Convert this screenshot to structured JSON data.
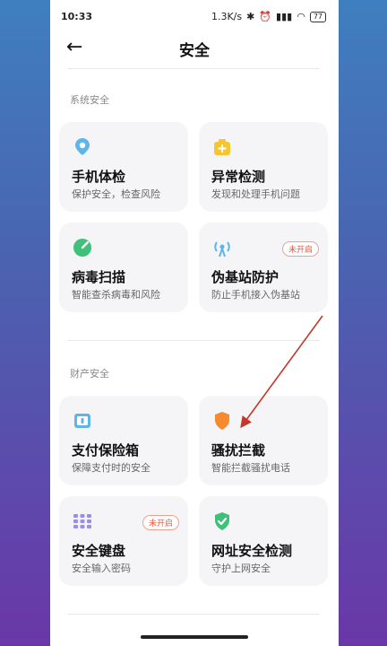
{
  "status_bar": {
    "time": "10:33",
    "net_speed": "1.3K/s",
    "battery": "77"
  },
  "header": {
    "title": "安全",
    "back_icon": "arrow-left-icon"
  },
  "sections": [
    {
      "label": "系统安全",
      "cards": [
        {
          "title": "手机体检",
          "subtitle": "保护安全，检查风险",
          "icon": "location-pin-icon",
          "badge": null
        },
        {
          "title": "异常检测",
          "subtitle": "发现和处理手机问题",
          "icon": "medkit-icon",
          "badge": null
        },
        {
          "title": "病毒扫描",
          "subtitle": "智能查杀病毒和风险",
          "icon": "scan-gauge-icon",
          "badge": null
        },
        {
          "title": "伪基站防护",
          "subtitle": "防止手机接入伪基站",
          "icon": "tower-signal-icon",
          "badge": "未开启"
        }
      ]
    },
    {
      "label": "财产安全",
      "cards": [
        {
          "title": "支付保险箱",
          "subtitle": "保障支付时的安全",
          "icon": "safe-box-icon",
          "badge": null
        },
        {
          "title": "骚扰拦截",
          "subtitle": "智能拦截骚扰电话",
          "icon": "shield-icon",
          "badge": null
        },
        {
          "title": "安全键盘",
          "subtitle": "安全输入密码",
          "icon": "keyboard-icon",
          "badge": "未开启"
        },
        {
          "title": "网址安全检测",
          "subtitle": "守护上网安全",
          "icon": "shield-check-icon",
          "badge": null
        }
      ]
    }
  ],
  "colors": {
    "card_bg": "#f5f5f7",
    "badge": "#e9573f",
    "annotation_arrow": "#c0392b"
  }
}
